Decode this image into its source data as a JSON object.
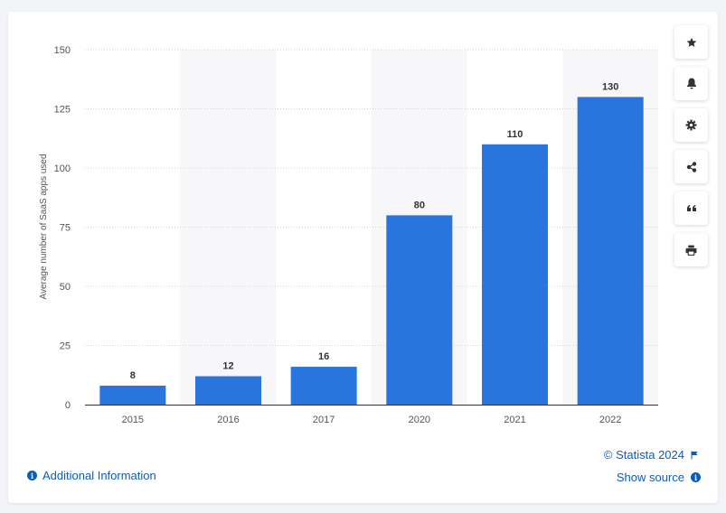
{
  "chart_data": {
    "type": "bar",
    "categories": [
      "2015",
      "2016",
      "2017",
      "2020",
      "2021",
      "2022"
    ],
    "values": [
      8,
      12,
      16,
      80,
      110,
      130
    ],
    "xlabel": "",
    "ylabel": "Average number of SaaS apps used",
    "ylim": [
      0,
      150
    ],
    "yticks": [
      0,
      25,
      50,
      75,
      100,
      125,
      150
    ],
    "grid": true,
    "alternating_band_background": true,
    "data_labels": true,
    "colors": {
      "bar": "#2876dd",
      "band": "#f7f7f9",
      "grid": "#d4d4d4",
      "tick_text": "#555555",
      "label_text": "#333333"
    }
  },
  "toolbar": {
    "buttons": [
      {
        "name": "favorite-button",
        "icon": "star-icon"
      },
      {
        "name": "notification-button",
        "icon": "bell-icon"
      },
      {
        "name": "settings-button",
        "icon": "gear-icon"
      },
      {
        "name": "share-button",
        "icon": "share-icon"
      },
      {
        "name": "cite-button",
        "icon": "quote-icon"
      },
      {
        "name": "print-button",
        "icon": "printer-icon"
      }
    ]
  },
  "footer": {
    "additional_info": "Additional Information",
    "copyright": "© Statista 2024",
    "show_source": "Show source"
  },
  "colors": {
    "link": "#0f5cb6",
    "icon": "#333333"
  }
}
